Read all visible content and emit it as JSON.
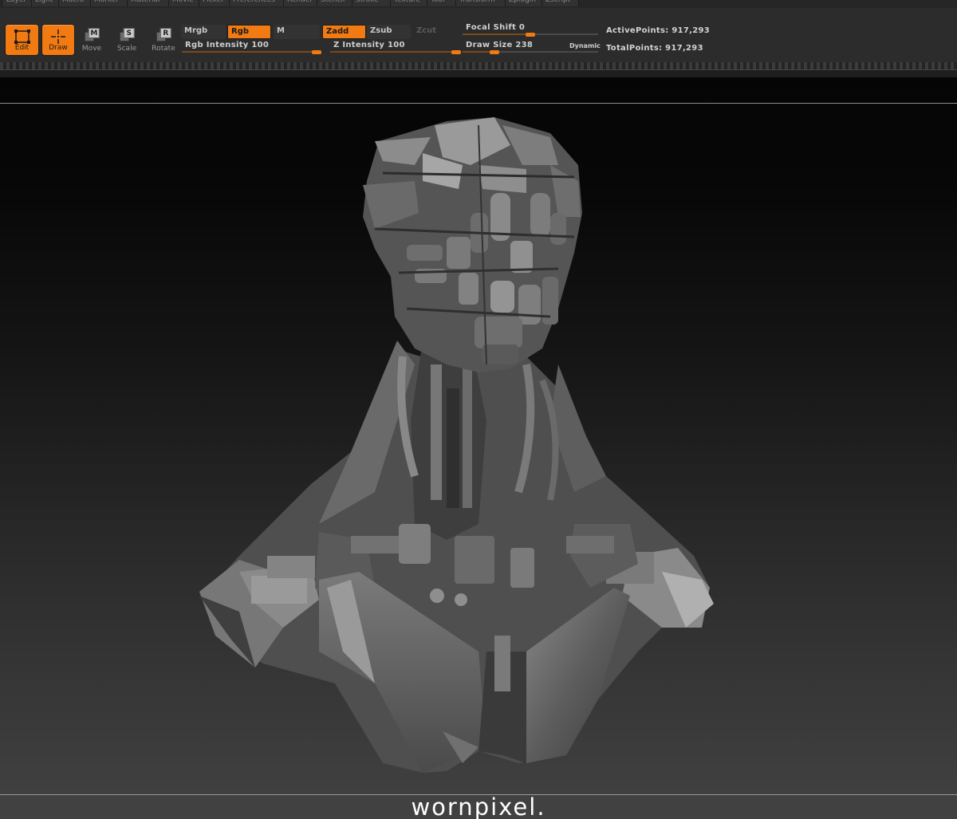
{
  "menu": [
    {
      "label": "Layer"
    },
    {
      "label": "Light"
    },
    {
      "label": "Macro"
    },
    {
      "label": "Marker"
    },
    {
      "label": "Material"
    },
    {
      "label": "Movie"
    },
    {
      "label": "Picker"
    },
    {
      "label": "Preferences"
    },
    {
      "label": "Render"
    },
    {
      "label": "Stencil"
    },
    {
      "label": "Stroke"
    },
    {
      "label": "Texture"
    },
    {
      "label": "Tool"
    },
    {
      "label": "Transform"
    },
    {
      "label": "Zplugin"
    },
    {
      "label": "Zscript"
    }
  ],
  "tools": {
    "edit": {
      "label": "Edit",
      "active": true
    },
    "draw": {
      "label": "Draw",
      "active": true
    },
    "move": {
      "label": "Move",
      "key": "M"
    },
    "scale": {
      "label": "Scale",
      "key": "S"
    },
    "rotate": {
      "label": "Rotate",
      "key": "R"
    }
  },
  "modes": {
    "mrgb": {
      "label": "Mrgb",
      "active": false
    },
    "rgb": {
      "label": "Rgb",
      "active": true
    },
    "m": {
      "label": "M",
      "active": false
    },
    "zadd": {
      "label": "Zadd",
      "active": true
    },
    "zsub": {
      "label": "Zsub",
      "active": false
    },
    "zcut": {
      "label": "Zcut",
      "active": false,
      "disabled": true
    }
  },
  "sliders": {
    "rgb_intensity": {
      "text": "Rgb  Intensity 100",
      "value": 100,
      "max": 100
    },
    "z_intensity": {
      "text": "Z  Intensity 100",
      "value": 100,
      "max": 100
    },
    "focal_shift": {
      "text": "Focal  Shift 0",
      "value": 0,
      "min": -100,
      "max": 100
    },
    "draw_size": {
      "text": "Draw  Size 238",
      "value": 238,
      "max": 1000
    }
  },
  "dynamic_label": "Dynamic",
  "stats": {
    "active_points": "ActivePoints: 917,293",
    "total_points": "TotalPoints: 917,293"
  },
  "watermark": "wornpixel.",
  "colors": {
    "accent": "#f27a12",
    "panel": "#2c2c2c",
    "text": "#cfcfcf"
  },
  "icons": {
    "edit": "edit-frame-icon",
    "draw": "draw-crosshair-icon",
    "move": "move-key-icon",
    "scale": "scale-key-icon",
    "rotate": "rotate-key-icon"
  }
}
